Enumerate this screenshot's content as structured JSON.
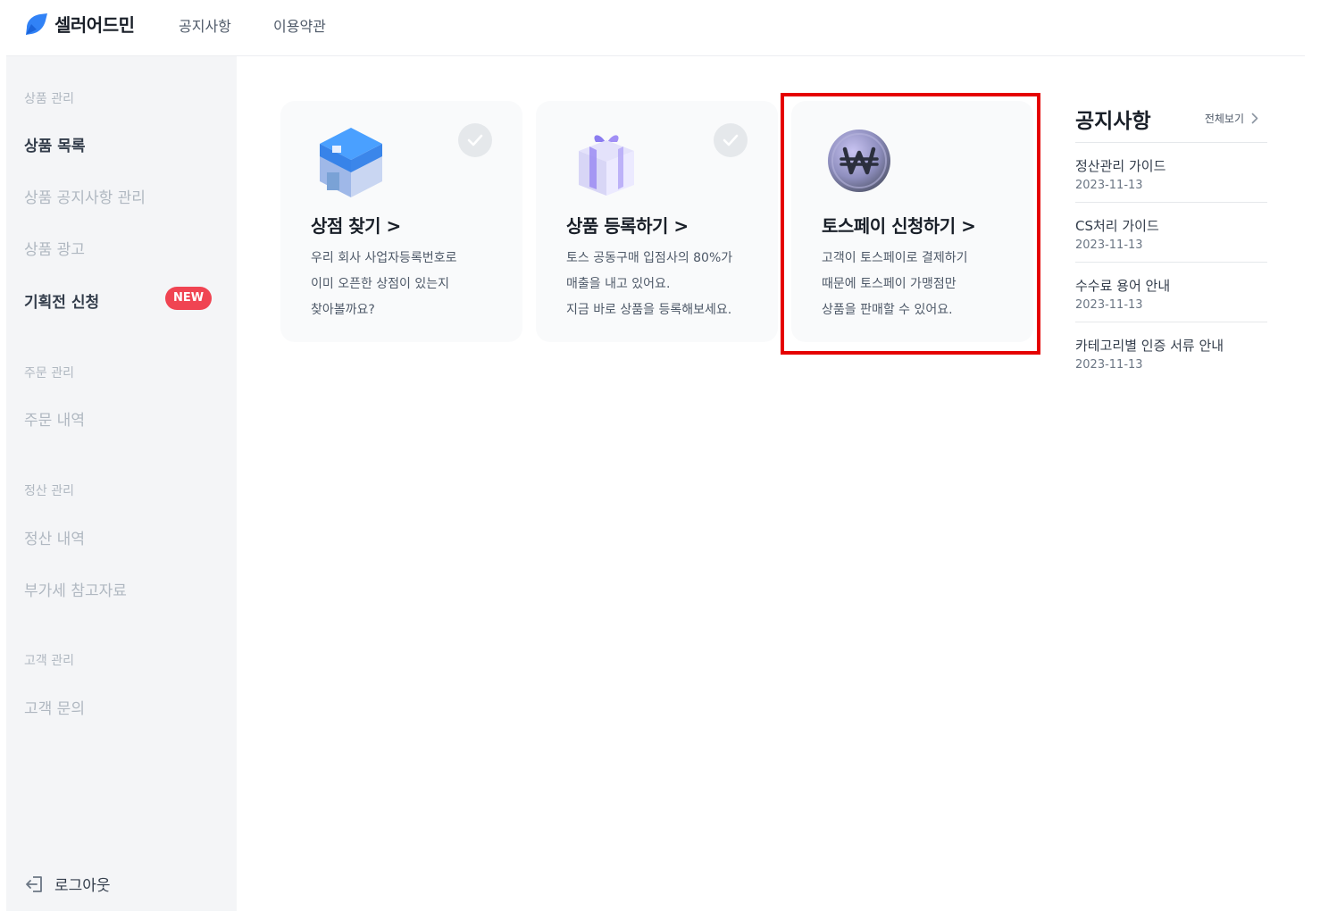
{
  "header": {
    "logo_text": "셀러어드민",
    "nav": [
      "공지사항",
      "이용약관"
    ],
    "brand_color": "#3182f6"
  },
  "sidebar": {
    "sections": [
      {
        "category": "상품 관리",
        "items": [
          "상품 목록",
          "상품 공지사항 관리",
          "상품 광고",
          "기획전 신청"
        ]
      },
      {
        "category": "주문 관리",
        "items": [
          "주문 내역"
        ]
      },
      {
        "category": "정산 관리",
        "items": [
          "정산 내역",
          "부가세 참고자료"
        ]
      },
      {
        "category": "고객 관리",
        "items": [
          "고객 문의"
        ]
      }
    ],
    "badge": "NEW",
    "badge_color": "#f04452",
    "logout": "로그아웃"
  },
  "cards": [
    {
      "title": "상점 찾기 >",
      "desc": [
        "우리 회사 사업자등록번호로",
        "이미 오픈한 상점이 있는지",
        "찾아볼까요?"
      ],
      "icon": "store-box-icon",
      "checked": true
    },
    {
      "title": "상품 등록하기 >",
      "desc": [
        "토스 공동구매 입점사의 80%가",
        "매출을 내고 있어요.",
        "지금 바로 상품을 등록해보세요."
      ],
      "icon": "gift-box-icon",
      "checked": true
    },
    {
      "title": "토스페이 신청하기 >",
      "desc": [
        "고객이 토스페이로 결제하기",
        "때문에 토스페이 가맹점만",
        "상품을 판매할 수 있어요."
      ],
      "icon": "won-coin-icon",
      "checked": false
    }
  ],
  "highlight_color": "#e50000",
  "notice": {
    "title": "공지사항",
    "view_all": "전체보기",
    "items": [
      {
        "title": "정산관리 가이드",
        "date": "2023-11-13"
      },
      {
        "title": "CS처리 가이드",
        "date": "2023-11-13"
      },
      {
        "title": "수수료 용어 안내",
        "date": "2023-11-13"
      },
      {
        "title": "카테고리별 인증 서류 안내",
        "date": "2023-11-13"
      }
    ]
  }
}
